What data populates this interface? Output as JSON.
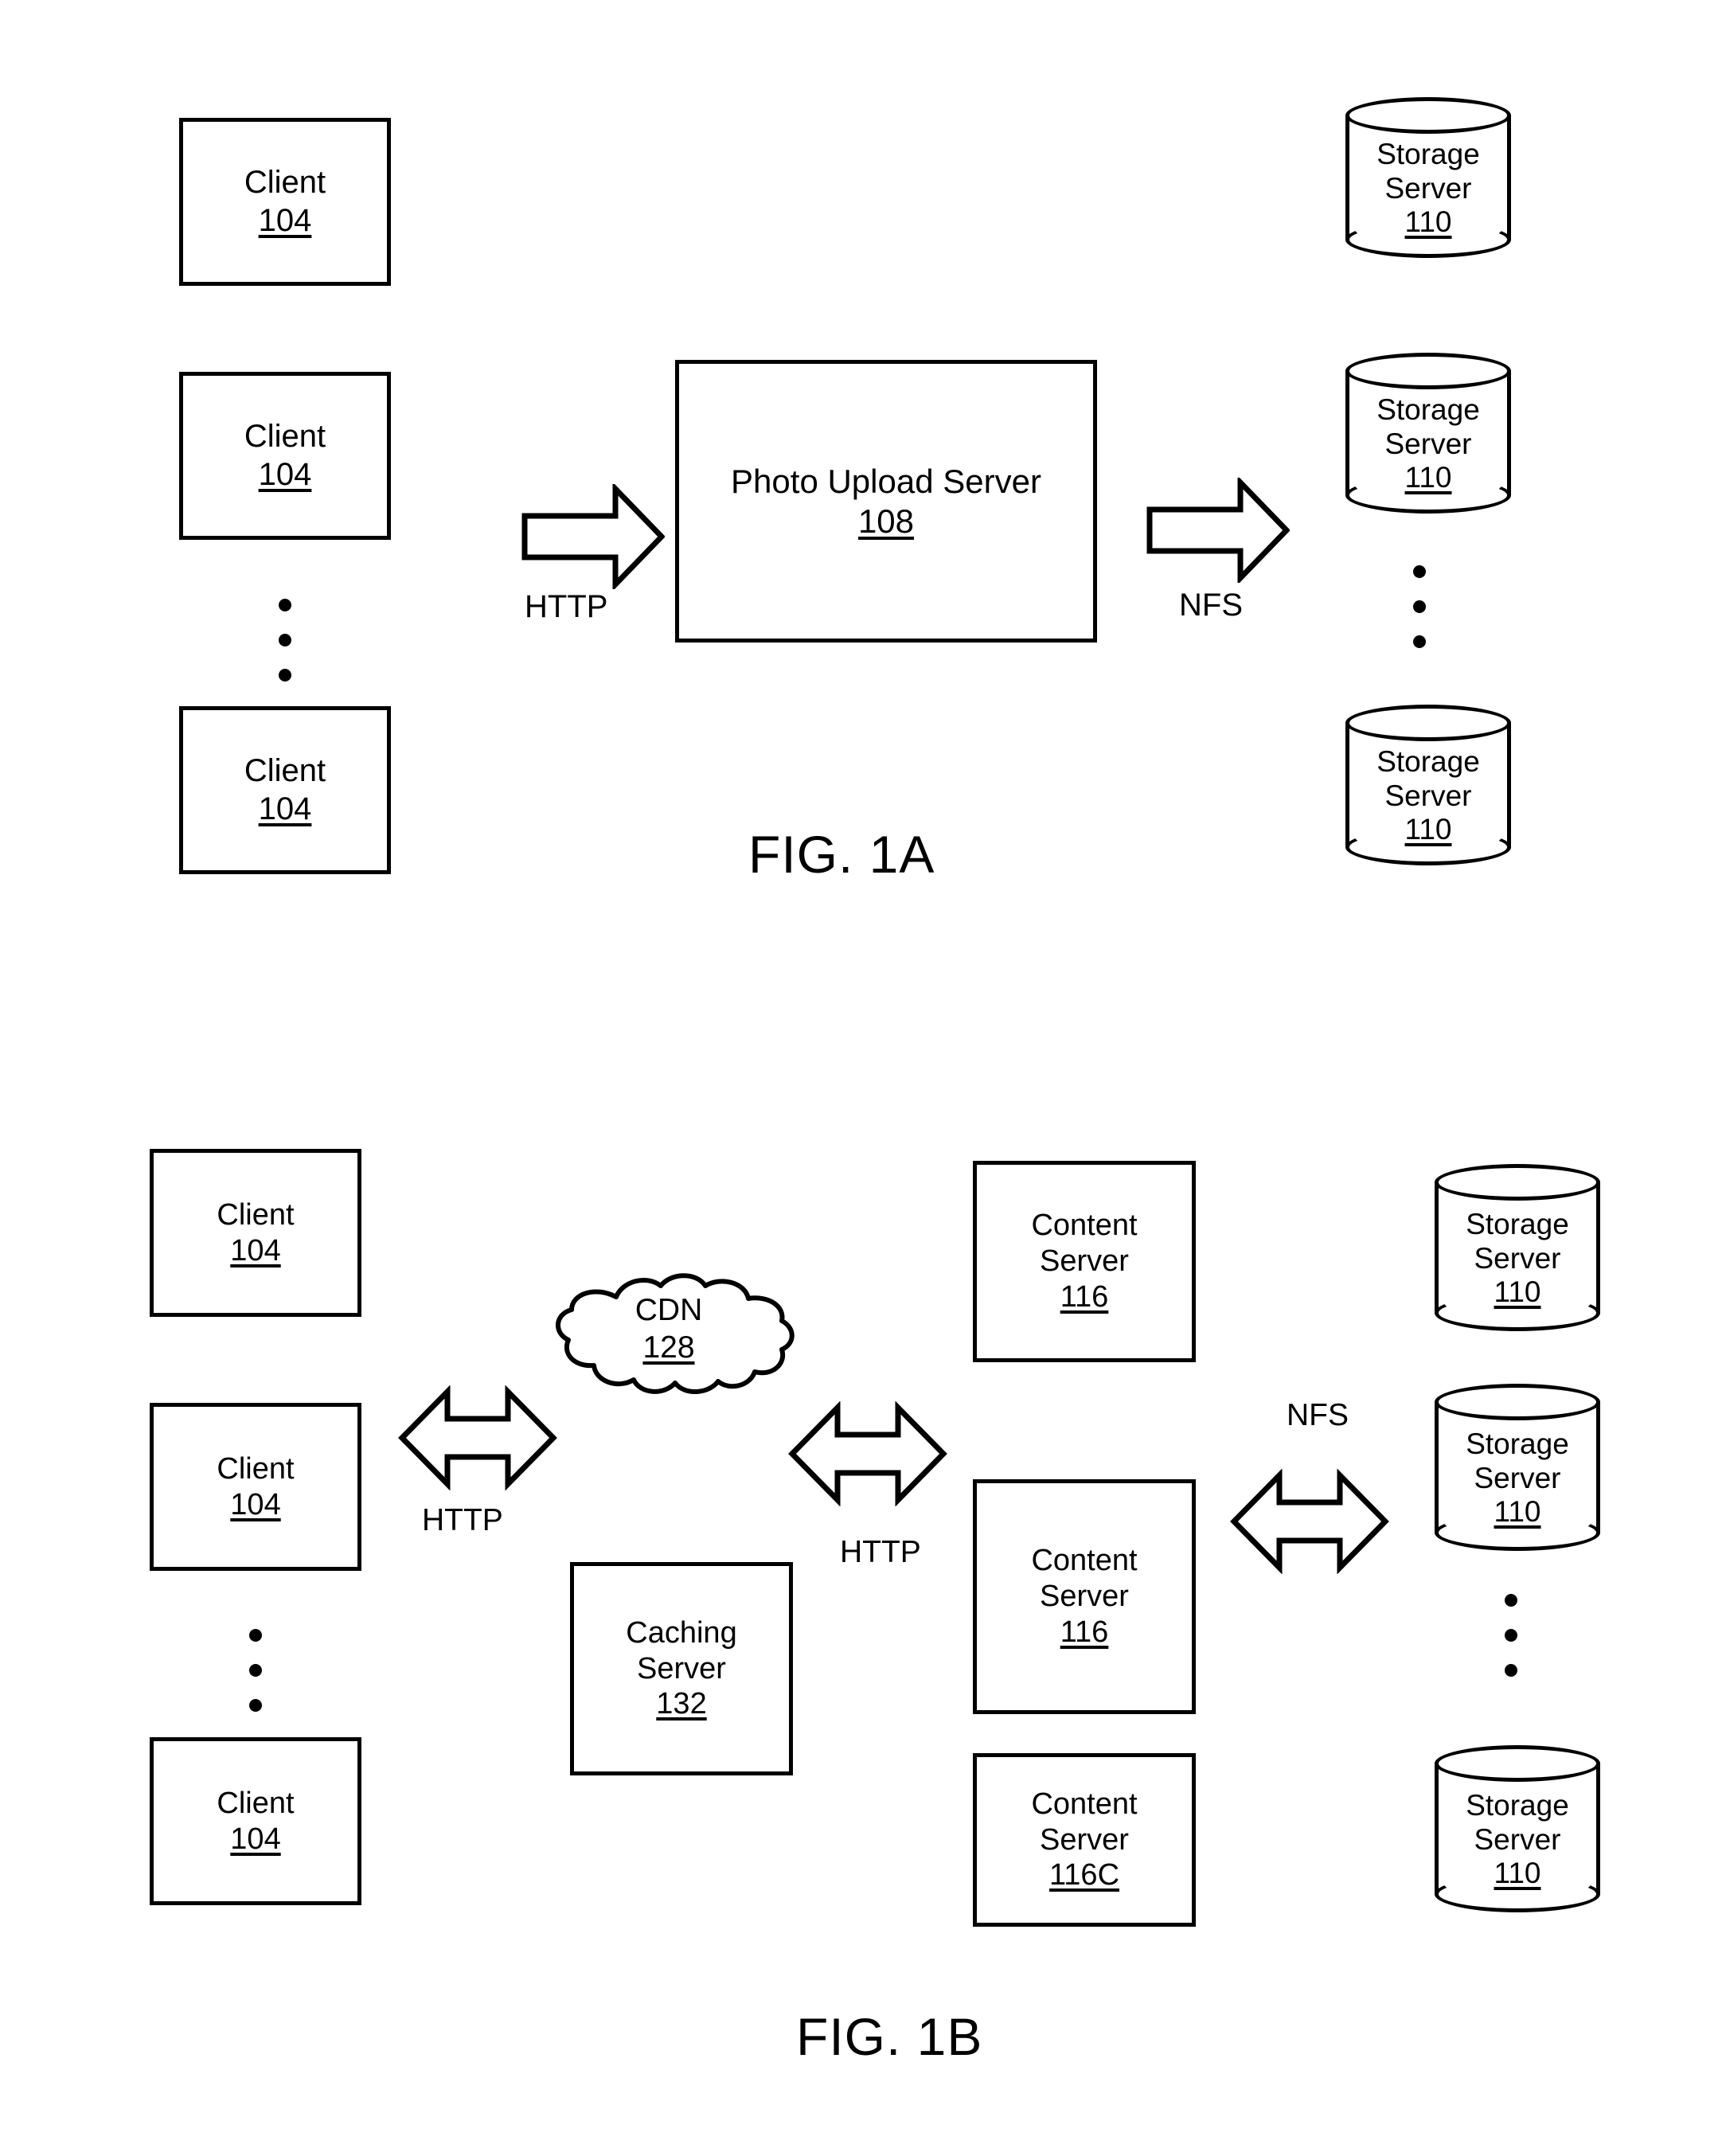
{
  "figures": [
    {
      "id": "fig1a",
      "caption": "FIG. 1A",
      "clients": [
        {
          "label": "Client",
          "ref": "104"
        },
        {
          "label": "Client",
          "ref": "104"
        },
        {
          "label": "Client",
          "ref": "104"
        }
      ],
      "client_ellipsis": "vertical-ellipsis",
      "server": {
        "label": "Photo Upload Server",
        "ref": "108"
      },
      "storage_servers": [
        {
          "label1": "Storage",
          "label2": "Server",
          "ref": "110"
        },
        {
          "label1": "Storage",
          "label2": "Server",
          "ref": "110"
        },
        {
          "label1": "Storage",
          "label2": "Server",
          "ref": "110"
        }
      ],
      "storage_ellipsis": "vertical-ellipsis",
      "arrows": [
        {
          "name": "http-arrow",
          "label": "HTTP",
          "direction": "right"
        },
        {
          "name": "nfs-arrow",
          "label": "NFS",
          "direction": "right"
        }
      ]
    },
    {
      "id": "fig1b",
      "caption": "FIG. 1B",
      "clients": [
        {
          "label": "Client",
          "ref": "104"
        },
        {
          "label": "Client",
          "ref": "104"
        },
        {
          "label": "Client",
          "ref": "104"
        }
      ],
      "client_ellipsis": "vertical-ellipsis",
      "cdn": {
        "label": "CDN",
        "ref": "128"
      },
      "caching_server": {
        "label1": "Caching",
        "label2": "Server",
        "ref": "132"
      },
      "content_servers": [
        {
          "label1": "Content",
          "label2": "Server",
          "ref": "116"
        },
        {
          "label1": "Content",
          "label2": "Server",
          "ref": "116"
        },
        {
          "label1": "Content",
          "label2": "Server",
          "ref": "116C"
        }
      ],
      "storage_servers": [
        {
          "label1": "Storage",
          "label2": "Server",
          "ref": "110"
        },
        {
          "label1": "Storage",
          "label2": "Server",
          "ref": "110"
        },
        {
          "label1": "Storage",
          "label2": "Server",
          "ref": "110"
        }
      ],
      "storage_ellipsis": "vertical-ellipsis",
      "arrows": [
        {
          "name": "http-arrow-left",
          "label": "HTTP",
          "direction": "bidirectional"
        },
        {
          "name": "http-arrow-right",
          "label": "HTTP",
          "direction": "bidirectional"
        },
        {
          "name": "nfs-arrow",
          "label": "NFS",
          "direction": "bidirectional"
        }
      ]
    }
  ],
  "style": {
    "stroke_color": "#000000",
    "background_color": "#ffffff"
  }
}
